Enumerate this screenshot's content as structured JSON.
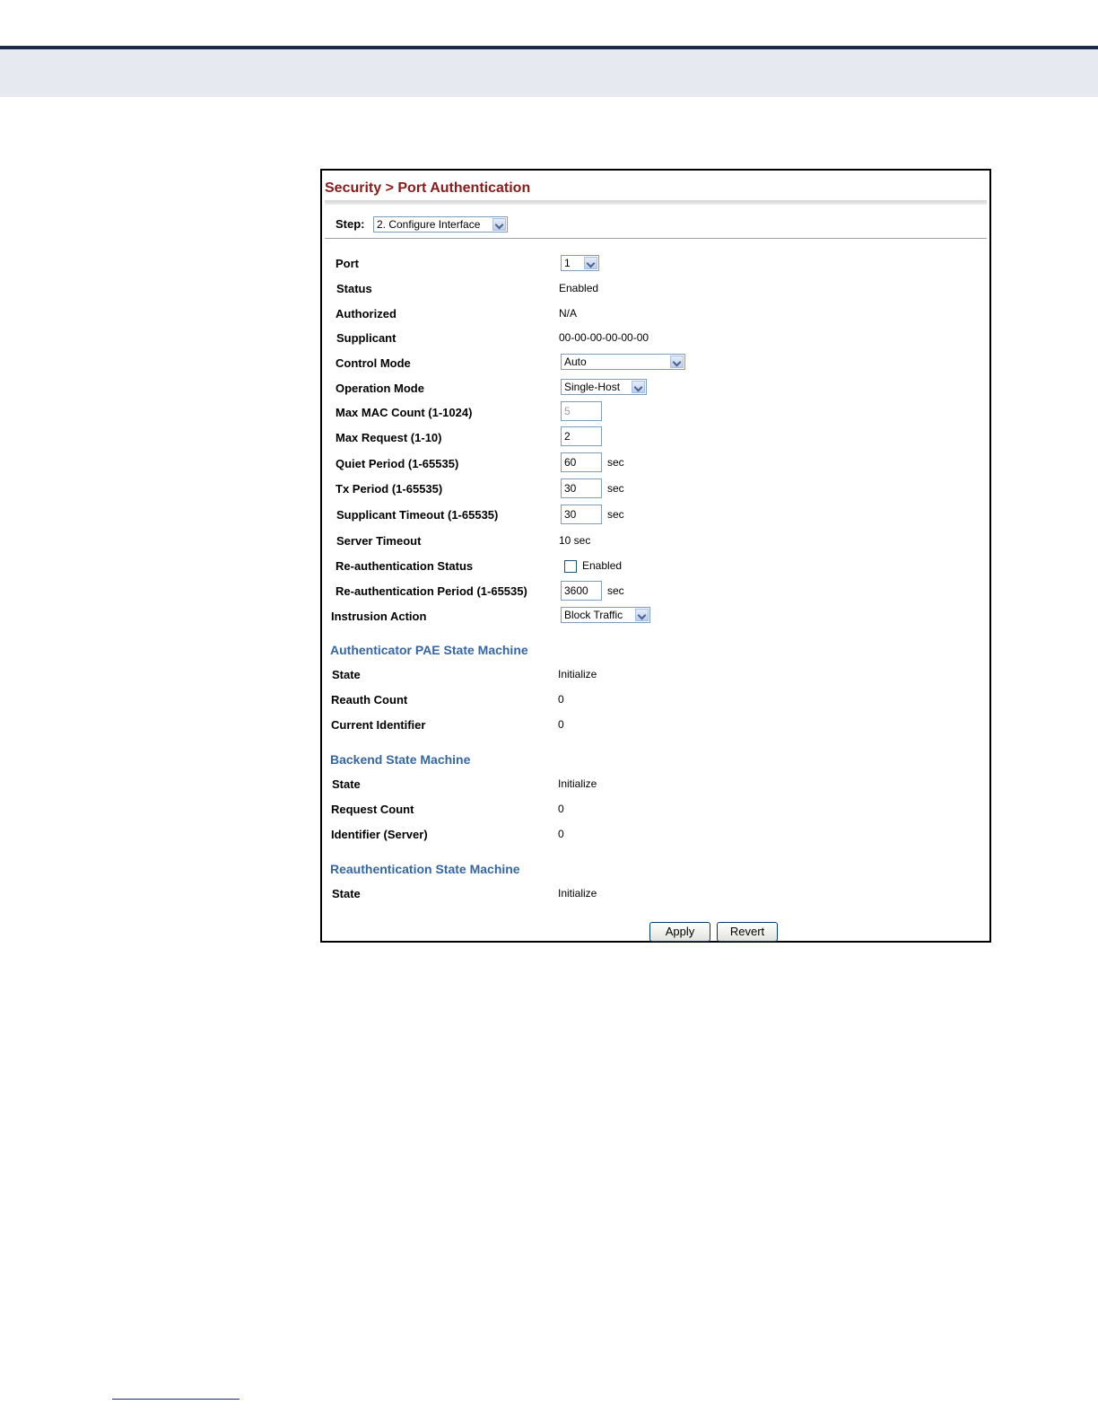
{
  "breadcrumb": {
    "text": "Security > Port Authentication"
  },
  "step": {
    "label": "Step:",
    "selected": "2. Configure Interface"
  },
  "fields": {
    "port": {
      "label": "Port",
      "value": "1"
    },
    "status": {
      "label": "Status",
      "value": "Enabled"
    },
    "authorized": {
      "label": "Authorized",
      "value": "N/A"
    },
    "supplicant": {
      "label": "Supplicant",
      "value": "00-00-00-00-00-00"
    },
    "control_mode": {
      "label": "Control Mode",
      "value": "Auto"
    },
    "operation_mode": {
      "label": "Operation Mode",
      "value": "Single-Host"
    },
    "max_mac_count": {
      "label": "Max MAC Count (1-1024)",
      "value": "5"
    },
    "max_request": {
      "label": "Max Request (1-10)",
      "value": "2"
    },
    "quiet_period": {
      "label": "Quiet Period (1-65535)",
      "value": "60",
      "unit": "sec"
    },
    "tx_period": {
      "label": "Tx Period (1-65535)",
      "value": "30",
      "unit": "sec"
    },
    "supplicant_timeout": {
      "label": "Supplicant Timeout (1-65535)",
      "value": "30",
      "unit": "sec"
    },
    "server_timeout": {
      "label": "Server Timeout",
      "value": "10 sec"
    },
    "reauth_status": {
      "label": "Re-authentication Status",
      "checkbox_label": "Enabled",
      "checked": false
    },
    "reauth_period": {
      "label": "Re-authentication Period (1-65535)",
      "value": "3600",
      "unit": "sec"
    },
    "intrusion_action": {
      "label": "Instrusion Action",
      "value": "Block Traffic"
    }
  },
  "authenticator_pae": {
    "heading": "Authenticator PAE State Machine",
    "state": {
      "label": "State",
      "value": "Initialize"
    },
    "reauth_count": {
      "label": "Reauth Count",
      "value": "0"
    },
    "current_identifier": {
      "label": "Current Identifier",
      "value": "0"
    }
  },
  "backend": {
    "heading": "Backend State Machine",
    "state": {
      "label": "State",
      "value": "Initialize"
    },
    "request_count": {
      "label": "Request Count",
      "value": "0"
    },
    "identifier_server": {
      "label": "Identifier (Server)",
      "value": "0"
    }
  },
  "reauthentication": {
    "heading": "Reauthentication State Machine",
    "state": {
      "label": "State",
      "value": "Initialize"
    }
  },
  "buttons": {
    "apply": "Apply",
    "revert": "Revert"
  },
  "colors": {
    "title": "#8b1a1a",
    "section_heading": "#3465a4",
    "header_bar": "#1a2a4a",
    "header_band": "#e6e9ef"
  }
}
